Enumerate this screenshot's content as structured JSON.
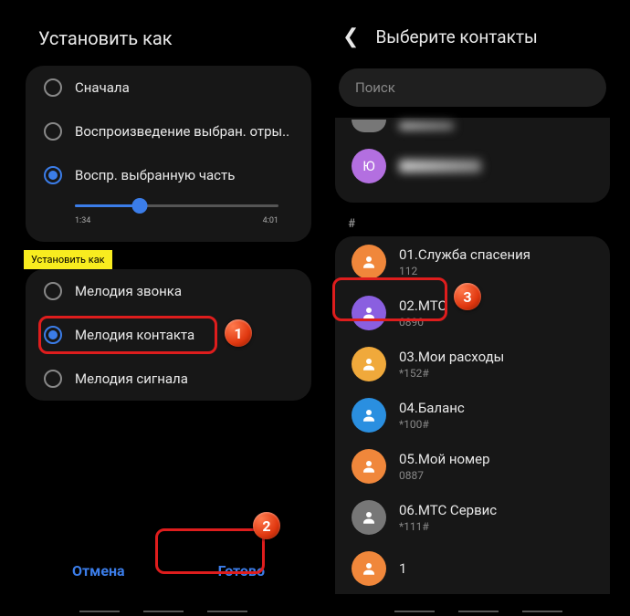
{
  "left": {
    "title": "Установить как",
    "playback": {
      "options": [
        {
          "label": "Сначала",
          "selected": false
        },
        {
          "label": "Воспроизведение выбран. отры..",
          "selected": false
        },
        {
          "label": "Воспр. выбранную часть",
          "selected": true
        }
      ],
      "slider": {
        "start": "1:34",
        "end": "4:01",
        "position_pct": 32
      }
    },
    "tag": "Установить как",
    "set_as": {
      "options": [
        {
          "label": "Мелодия звонка",
          "selected": false
        },
        {
          "label": "Мелодия контакта",
          "selected": true
        },
        {
          "label": "Мелодия сигнала",
          "selected": false
        }
      ]
    },
    "buttons": {
      "cancel": "Отмена",
      "done": "Готово"
    }
  },
  "right": {
    "header_title": "Выберите контакты",
    "search_placeholder": "Поиск",
    "top_contact": {
      "initial": "Ю",
      "avatar_color": "#b36fe0"
    },
    "section": "#",
    "contacts": [
      {
        "name": "01.Служба спасения",
        "sub": "112",
        "color": "#f0873b",
        "icon": "person"
      },
      {
        "name": "02.МТС",
        "sub": "0890",
        "color": "#8a5fe0",
        "icon": "person"
      },
      {
        "name": "03.Мои расходы",
        "sub": "*152#",
        "color": "#f0a93b",
        "icon": "person"
      },
      {
        "name": "04.Баланс",
        "sub": "*100#",
        "color": "#2a8fe0",
        "icon": "person"
      },
      {
        "name": "05.Мой номер",
        "sub": "0887",
        "color": "#f0873b",
        "icon": "person"
      },
      {
        "name": "06.МТС Сервис",
        "sub": "*111#",
        "color": "#777",
        "icon": "person"
      },
      {
        "name": "1",
        "sub": "",
        "color": "#f0873b",
        "icon": "person"
      }
    ]
  },
  "markers": {
    "m1": "1",
    "m2": "2",
    "m3": "3"
  }
}
